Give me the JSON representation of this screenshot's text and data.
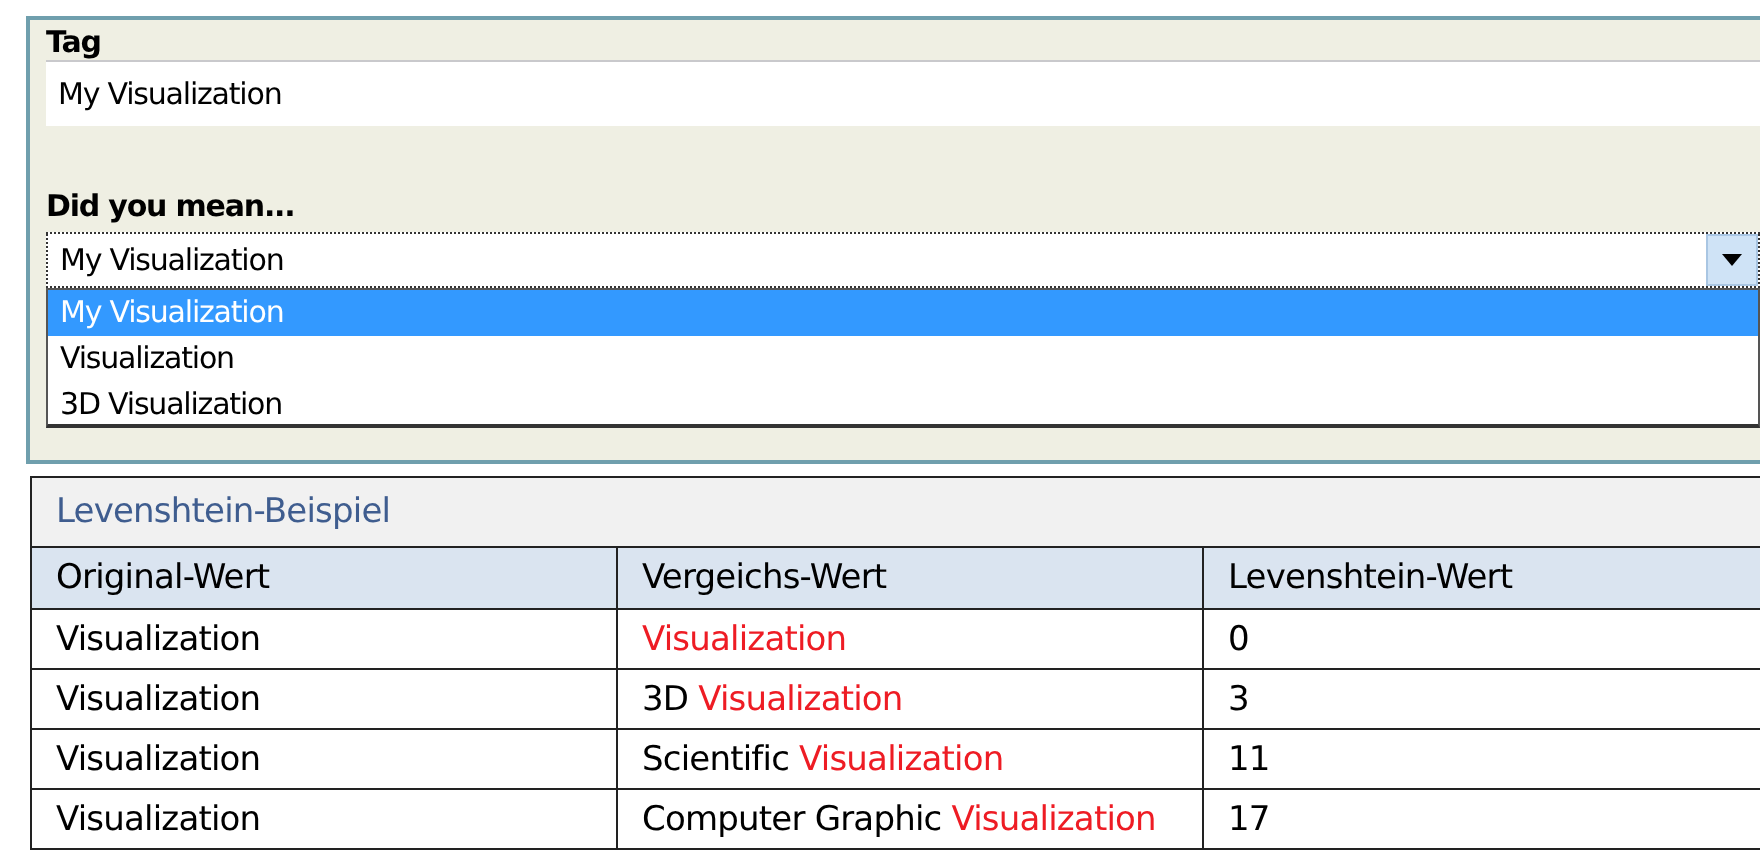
{
  "tag": {
    "label": "Tag",
    "value": "My Visualization"
  },
  "suggestions": {
    "label": "Did you mean...",
    "value": "My Visualization",
    "expanded": true,
    "options": [
      {
        "label": "My Visualization",
        "selected": true
      },
      {
        "label": "Visualization",
        "selected": false
      },
      {
        "label": "3D Visualization",
        "selected": false
      }
    ]
  },
  "table": {
    "title": "Levenshtein-Beispiel",
    "columns": [
      "Original-Wert",
      "Vergeichs-Wert",
      "Levenshtein-Wert"
    ],
    "rows": [
      {
        "original": "Visualization",
        "match": "Visualization",
        "distance": "0"
      },
      {
        "original": "Visualization",
        "prefix": "3D",
        "match": "Visualization",
        "distance": "3"
      },
      {
        "original": "Visualization",
        "prefix": "Scientific",
        "match": "Visualization",
        "distance": "11"
      },
      {
        "original": "Visualization",
        "prefix": "Computer Graphic",
        "match": "Visualization",
        "distance": "17"
      }
    ]
  }
}
